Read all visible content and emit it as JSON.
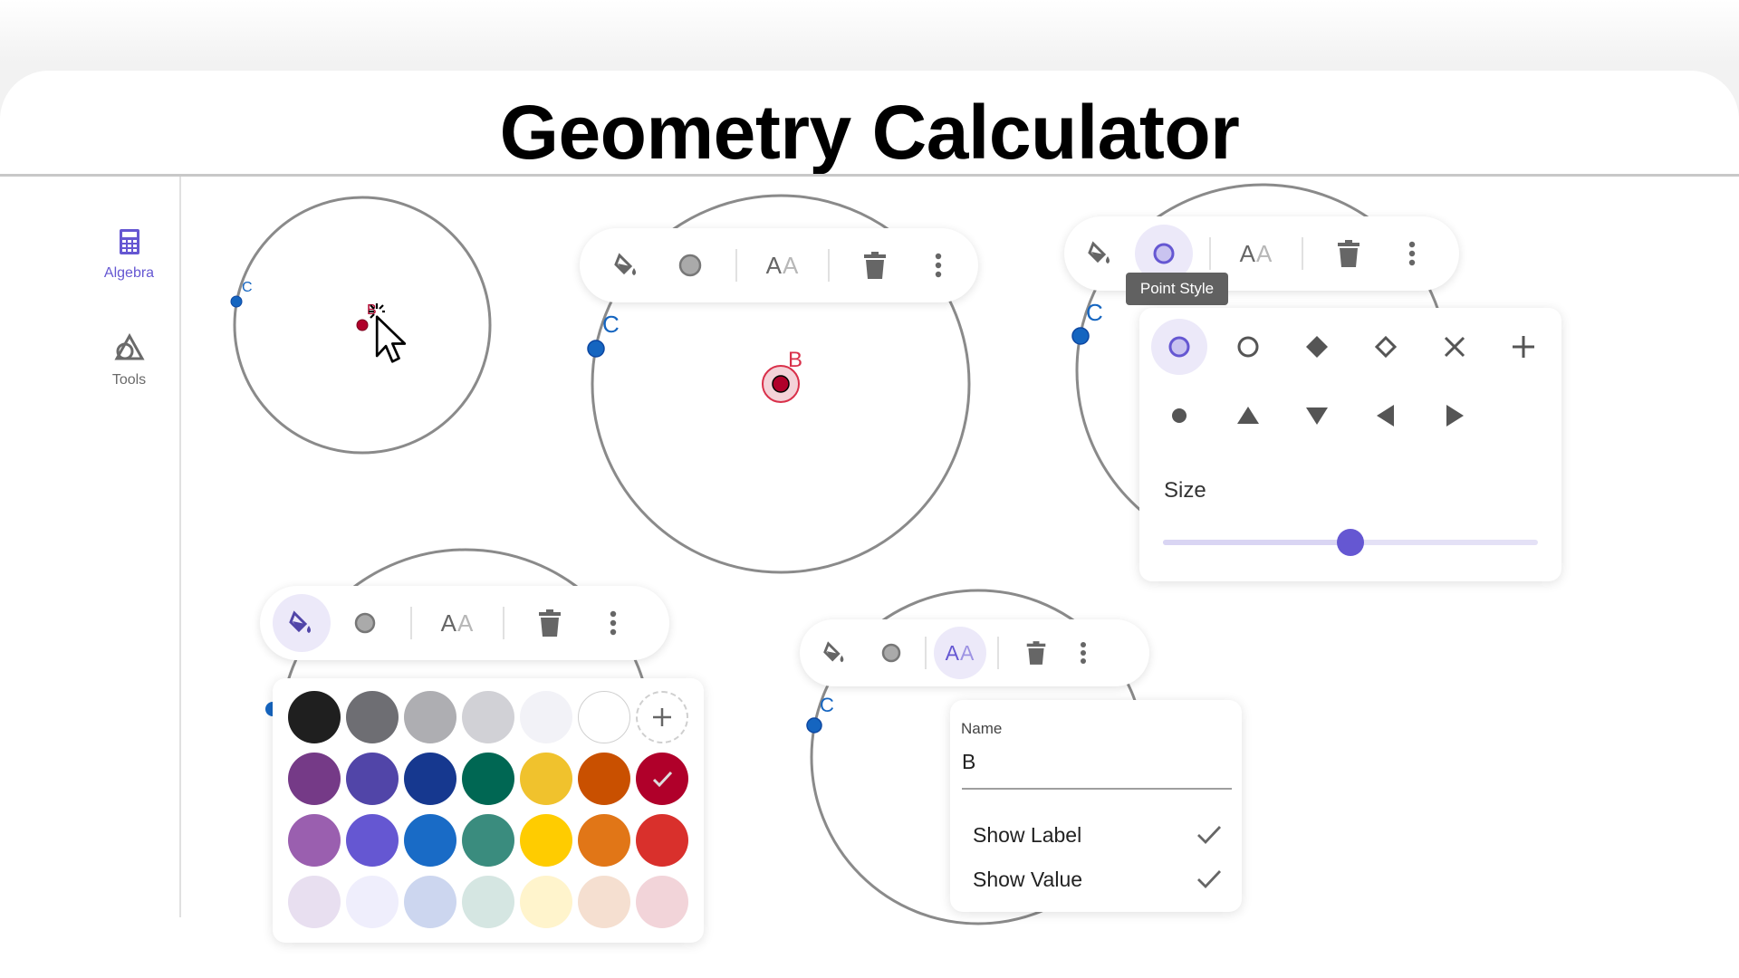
{
  "page": {
    "title": "Geometry Calculator"
  },
  "sidebar": {
    "items": [
      {
        "label": "Algebra",
        "icon": "calculator-icon",
        "active": true
      },
      {
        "label": "Tools",
        "icon": "shapes-icon",
        "active": false
      }
    ]
  },
  "points": {
    "b_label": "B",
    "c_label": "C"
  },
  "toolbar": {
    "icons": [
      "paint-bucket-icon",
      "point-style-icon",
      "label-text-icon",
      "trash-icon",
      "more-vert-icon"
    ],
    "label_text": "AA"
  },
  "tooltip": {
    "text": "Point Style"
  },
  "point_style_menu": {
    "styles": [
      "circle-filled-outline",
      "circle-outline",
      "diamond-filled",
      "diamond-outline",
      "cross",
      "plus",
      "dot",
      "triangle-up",
      "triangle-down",
      "triangle-left",
      "triangle-right"
    ],
    "selected": "circle-filled-outline",
    "size_label": "Size",
    "size_value": 0.5
  },
  "color_palette": {
    "rows": [
      [
        "#1f1f1f",
        "#6e6e73",
        "#aeaeb2",
        "#d1d1d6",
        "#f2f2f7",
        "#ffffff",
        "add"
      ],
      [
        "#753a87",
        "#5145a8",
        "#16388f",
        "#006753",
        "#f0c22d",
        "#c95000",
        "#b0002a"
      ],
      [
        "#9a5faf",
        "#6557d2",
        "#196bc6",
        "#3a8c7e",
        "#ffcc00",
        "#e17617",
        "#d9302c"
      ],
      [
        "#e8dff0",
        "#efeefc",
        "#ccd6ef",
        "#d5e6e2",
        "#fff4cc",
        "#f5dfd0",
        "#f2d4d9"
      ]
    ],
    "selected": "#b0002a",
    "accent": "#6557d2"
  },
  "label_menu": {
    "name_label": "Name",
    "name_value": "B",
    "items": [
      {
        "label": "Show Label",
        "checked": true
      },
      {
        "label": "Show Value",
        "checked": true
      }
    ]
  }
}
